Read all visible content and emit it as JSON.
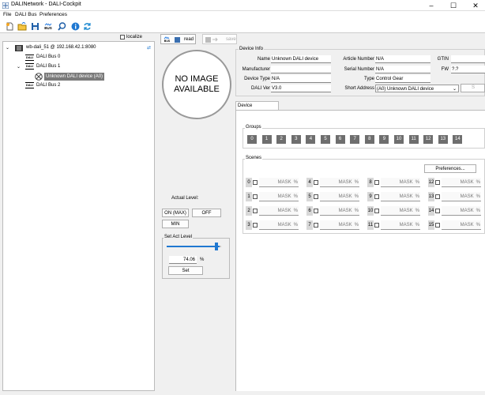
{
  "window": {
    "title": "DALINetwork - DALI-Cockpit"
  },
  "menu": [
    "File",
    "DALI Bus",
    "Preferences"
  ],
  "toolbar_icons": [
    "new-icon",
    "open-icon",
    "save-icon",
    "bus-icon",
    "search-icon",
    "info-icon",
    "refresh-icon"
  ],
  "toolbar": {
    "bus_label": "BUS"
  },
  "tree": {
    "localize_label": "localize",
    "root": "wb-dali_51 @ 192.168.42.1:8080",
    "bus0": "DALI Bus 0",
    "bus1": "DALI Bus 1",
    "device": "Unknown DALI device (A0)",
    "bus2": "DALI Bus 2",
    "bus_icon_text": "DALI"
  },
  "actions": {
    "read": "read",
    "save": "save",
    "read_icon_text": "BUS"
  },
  "image_placeholder": {
    "line1": "NO IMAGE",
    "line2": "AVAILABLE"
  },
  "device_info": {
    "legend": "Device Info",
    "name_label": "Name",
    "name_value": "Unknown DALI device",
    "manufacturer_label": "Manufacturer",
    "manufacturer_value": "",
    "device_type_label": "Device Type",
    "device_type_value": "N/A",
    "dali_ver_label": "DALI Ver",
    "dali_ver_value": "V3.0",
    "article_label": "Article Number",
    "article_value": "N/A",
    "serial_label": "Serial Number",
    "serial_value": "N/A",
    "type_label": "Type",
    "type_value": "Control Gear",
    "short_addr_label": "Short Address",
    "short_addr_value": "(A0) Unknown DALI device",
    "gtin_label": "GTIN",
    "gtin_value": "",
    "fw_label": "FW",
    "fw_value": "?.?"
  },
  "tabs": {
    "device_params": "Device Parameters"
  },
  "groups": {
    "legend": "Groups",
    "items": [
      "0",
      "1",
      "2",
      "3",
      "4",
      "5",
      "6",
      "7",
      "8",
      "9",
      "10",
      "11",
      "12",
      "13",
      "14"
    ]
  },
  "scenes": {
    "legend": "Scenes",
    "preferences": "Preferences...",
    "mask": "MASK",
    "unit": "%",
    "items": [
      "0",
      "1",
      "2",
      "3",
      "4",
      "5",
      "6",
      "7",
      "8",
      "9",
      "10",
      "11",
      "12",
      "13",
      "14",
      "15"
    ]
  },
  "level": {
    "actual_label": "Actual Level:",
    "on_max": "ON (MAX)",
    "off": "OFF",
    "min": "MIN",
    "set_act_legend": "Set Act Level",
    "value": "74.06",
    "unit": "%",
    "set": "Set",
    "slider_fraction": 0.97
  }
}
